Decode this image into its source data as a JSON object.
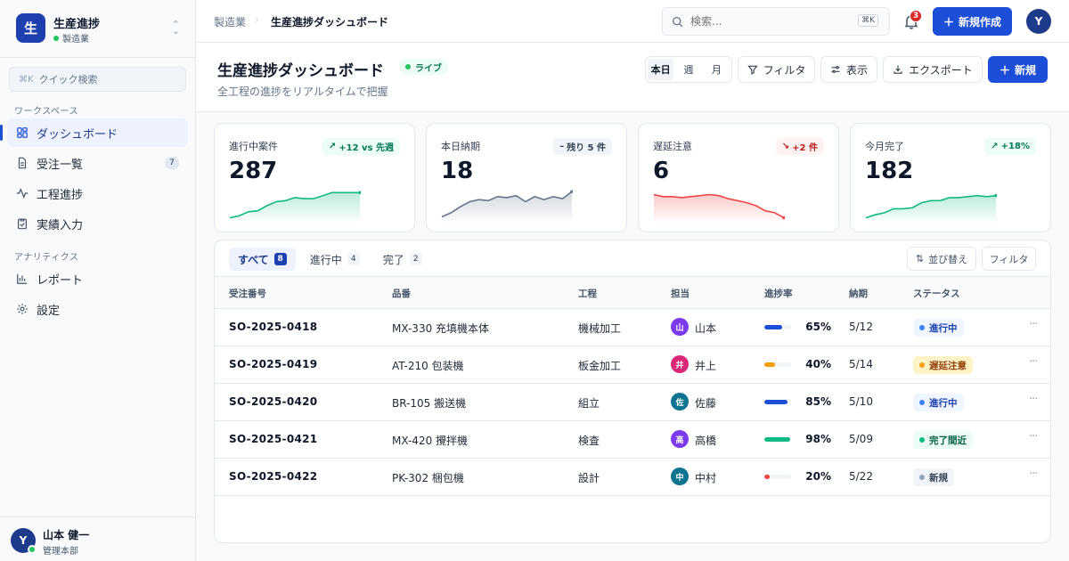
{
  "brand": {
    "logo_char": "生",
    "name": "生産進捗",
    "sub": "製造業"
  },
  "sidebar": {
    "quick_search_kbd": "⌘K",
    "quick_search_placeholder": "クイック検索",
    "section_workspace": "ワークスペース",
    "section_analytics": "アナリティクス",
    "items": [
      {
        "label": "ダッシュボード",
        "icon": "dashboard-icon",
        "active": true
      },
      {
        "label": "受注一覧",
        "icon": "document-icon",
        "badge": "7"
      },
      {
        "label": "工程進捗",
        "icon": "activity-icon"
      },
      {
        "label": "実績入力",
        "icon": "clipboard-icon"
      },
      {
        "label": "レポート",
        "icon": "bar-chart-icon"
      },
      {
        "label": "設定",
        "icon": "gear-icon"
      }
    ],
    "user": {
      "initial": "Y",
      "name": "山本 健一",
      "role": "管理本部"
    }
  },
  "topbar": {
    "breadcrumb": [
      "製造業",
      "生産進捗ダッシュボード"
    ],
    "search_placeholder": "検索...",
    "search_kbd": "⌘K",
    "notifications": "3",
    "new_button": "新規作成",
    "avatar": "Y"
  },
  "header": {
    "title": "生産進捗ダッシュボード",
    "live": "ライブ",
    "subtitle": "全工程の進捗をリアルタイムで把握",
    "period": [
      "本日",
      "週",
      "月"
    ],
    "filter": "フィルタ",
    "view": "表示",
    "export": "エクスポート",
    "new": "新規"
  },
  "cards": [
    {
      "label": "進行中案件",
      "value": "287",
      "delta": "+12 vs 先週",
      "trend": "up",
      "color": "#10b981",
      "spark": [
        3,
        5,
        9,
        10,
        15,
        19,
        20,
        23,
        22,
        22,
        25,
        28,
        28,
        28,
        28
      ]
    },
    {
      "label": "本日納期",
      "value": "18",
      "delta": "残り 5 件",
      "trend": "flat",
      "color": "#64748b",
      "spark": [
        4,
        8,
        14,
        19,
        21,
        20,
        24,
        23,
        25,
        19,
        24,
        21,
        24,
        22,
        29
      ]
    },
    {
      "label": "遅延注意",
      "value": "6",
      "delta": "+2 件",
      "trend": "down",
      "color": "#ef4444",
      "spark": [
        26,
        24,
        24,
        23,
        24,
        25,
        26,
        25,
        22,
        20,
        18,
        15,
        10,
        8,
        3
      ]
    },
    {
      "label": "今月完了",
      "value": "182",
      "delta": "+18%",
      "trend": "up",
      "color": "#10b981",
      "spark": [
        3,
        6,
        8,
        12,
        12,
        13,
        18,
        20,
        20,
        23,
        23,
        24,
        25,
        24,
        25
      ]
    }
  ],
  "table": {
    "tabs": [
      {
        "label": "すべて",
        "count": "8",
        "active": true
      },
      {
        "label": "進行中",
        "count": "4"
      },
      {
        "label": "完了",
        "count": "2"
      }
    ],
    "sort": "並び替え",
    "filter": "フィルタ",
    "columns": [
      "受注番号",
      "品番",
      "工程",
      "担当",
      "進捗率",
      "納期",
      "ステータス"
    ],
    "rows": [
      {
        "id": "SO-2025-0418",
        "product": "MX-330 充填機本体",
        "process": "機械加工",
        "assignee_initial": "山",
        "assignee": "山本",
        "avatar_color": "#7c3aed",
        "progress": 65,
        "progress_label": "65%",
        "bar_color": "#1d4ed8",
        "due": "5/12",
        "status": "進行中",
        "status_bg": "#eff6ff",
        "status_fg": "#1e40af",
        "status_dot": "#3b82f6"
      },
      {
        "id": "SO-2025-0419",
        "product": "AT-210 包装機",
        "process": "板金加工",
        "assignee_initial": "井",
        "assignee": "井上",
        "avatar_color": "#db2777",
        "progress": 40,
        "progress_label": "40%",
        "bar_color": "#f59e0b",
        "due": "5/14",
        "status": "遅延注意",
        "status_bg": "#fef3c7",
        "status_fg": "#92400e",
        "status_dot": "#f59e0b"
      },
      {
        "id": "SO-2025-0420",
        "product": "BR-105 搬送機",
        "process": "組立",
        "assignee_initial": "佐",
        "assignee": "佐藤",
        "avatar_color": "#0e7490",
        "progress": 85,
        "progress_label": "85%",
        "bar_color": "#1d4ed8",
        "due": "5/10",
        "status": "進行中",
        "status_bg": "#eff6ff",
        "status_fg": "#1e40af",
        "status_dot": "#3b82f6"
      },
      {
        "id": "SO-2025-0421",
        "product": "MX-420 攪拌機",
        "process": "検査",
        "assignee_initial": "高",
        "assignee": "高橋",
        "avatar_color": "#7c3aed",
        "progress": 98,
        "progress_label": "98%",
        "bar_color": "#10b981",
        "due": "5/09",
        "status": "完了間近",
        "status_bg": "#ecfdf5",
        "status_fg": "#065f46",
        "status_dot": "#10b981"
      },
      {
        "id": "SO-2025-0422",
        "product": "PK-302 梱包機",
        "process": "設計",
        "assignee_initial": "中",
        "assignee": "中村",
        "avatar_color": "#0e7490",
        "progress": 20,
        "progress_label": "20%",
        "bar_color": "#ef4444",
        "due": "5/22",
        "status": "新規",
        "status_bg": "#f1f5f9",
        "status_fg": "#334155",
        "status_dot": "#94a3b8"
      }
    ]
  }
}
